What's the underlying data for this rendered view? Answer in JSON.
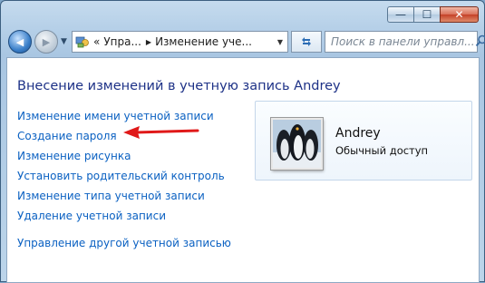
{
  "window": {
    "caption_buttons": [
      {
        "name": "minimize",
        "glyph": "—"
      },
      {
        "name": "maximize",
        "glyph": "☐"
      },
      {
        "name": "close",
        "glyph": "✕"
      }
    ]
  },
  "nav": {
    "back_glyph": "◀",
    "forward_glyph": "▶",
    "address": {
      "overflow": "«",
      "segments": [
        "Упра...",
        "Изменение уче..."
      ],
      "separator": "▶"
    },
    "search_placeholder": "Поиск в панели управл..."
  },
  "page": {
    "heading": "Внесение изменений в учетную запись Andrey",
    "links": [
      "Изменение имени учетной записи",
      "Создание пароля",
      "Изменение рисунка",
      "Установить родительский контроль",
      "Изменение типа учетной записи",
      "Удаление учетной записи"
    ],
    "other_link": "Управление другой учетной записью"
  },
  "account": {
    "name": "Andrey",
    "type": "Обычный доступ"
  },
  "colors": {
    "link": "#0b61c2",
    "heading": "#1e3287",
    "annotation_arrow": "#e01919"
  },
  "icons": [
    "back-arrow-icon",
    "forward-arrow-icon",
    "control-panel-icon",
    "refresh-icon",
    "search-icon",
    "penguins-avatar"
  ]
}
